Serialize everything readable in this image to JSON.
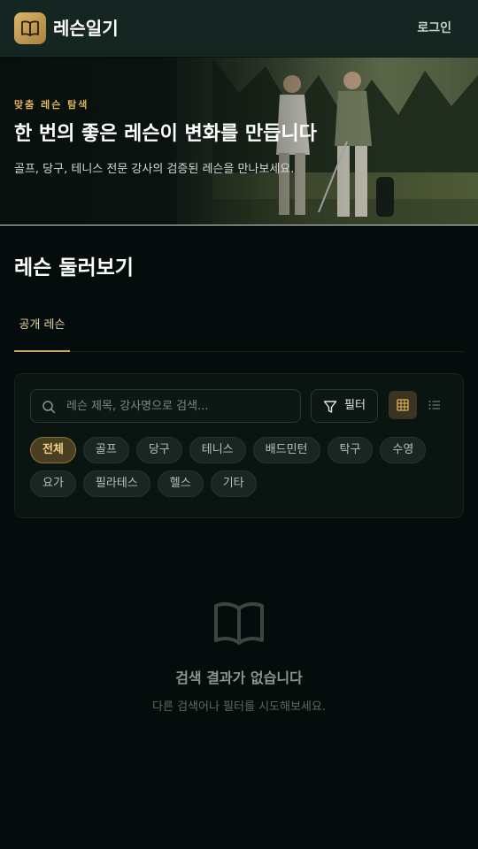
{
  "header": {
    "app_title": "레슨일기",
    "login_label": "로그인"
  },
  "hero": {
    "eyebrow": "맞춤 레슨 탐색",
    "title": "한 번의 좋은 레슨이 변화를 만듭니다",
    "subtitle": "골프, 당구, 테니스 전문 강사의 검증된 레슨을 만나보세요."
  },
  "main": {
    "section_title": "레슨 둘러보기",
    "tabs": [
      {
        "label": "공개 레슨",
        "active": true
      }
    ]
  },
  "search": {
    "placeholder": "레슨 제목, 강사명으로 검색...",
    "value": "",
    "filter_label": "필터",
    "view_mode": "grid"
  },
  "categories": [
    {
      "label": "전체",
      "active": true
    },
    {
      "label": "골프",
      "active": false
    },
    {
      "label": "당구",
      "active": false
    },
    {
      "label": "테니스",
      "active": false
    },
    {
      "label": "배드민턴",
      "active": false
    },
    {
      "label": "탁구",
      "active": false
    },
    {
      "label": "수영",
      "active": false
    },
    {
      "label": "요가",
      "active": false
    },
    {
      "label": "필라테스",
      "active": false
    },
    {
      "label": "헬스",
      "active": false
    },
    {
      "label": "기타",
      "active": false
    }
  ],
  "empty_state": {
    "title": "검색 결과가 없습니다",
    "subtitle": "다른 검색어나 필터를 시도해보세요."
  },
  "colors": {
    "accent": "#c9a461",
    "background": "#040d0b",
    "header_bg": "#152622"
  }
}
